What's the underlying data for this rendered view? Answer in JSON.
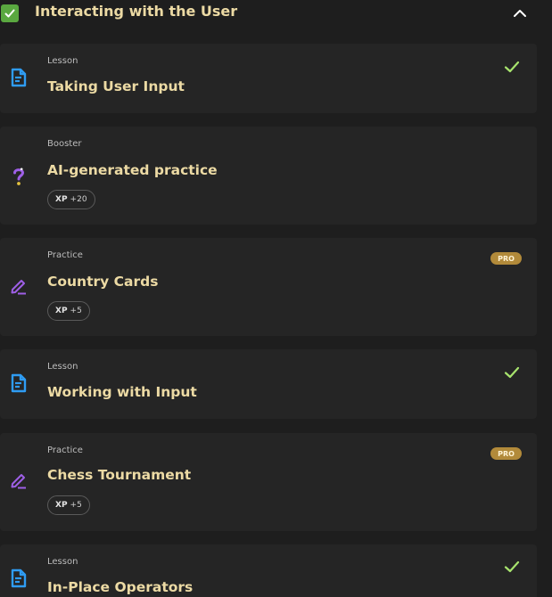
{
  "section": {
    "title": "Interacting with the User",
    "completed": true,
    "expanded": true
  },
  "items": [
    {
      "type": "Lesson",
      "title": "Taking User Input",
      "icon": "lesson-icon",
      "completed": true
    },
    {
      "type": "Booster",
      "title": "AI-generated practice",
      "icon": "question-mark-icon",
      "xp_label": "XP",
      "xp_value": "+20"
    },
    {
      "type": "Practice",
      "title": "Country Cards",
      "icon": "pencil-icon",
      "pro_label": "PRO",
      "xp_label": "XP",
      "xp_value": "+5"
    },
    {
      "type": "Lesson",
      "title": "Working with Input",
      "icon": "lesson-icon",
      "completed": true
    },
    {
      "type": "Practice",
      "title": "Chess Tournament",
      "icon": "pencil-icon",
      "pro_label": "PRO",
      "xp_label": "XP",
      "xp_value": "+5"
    },
    {
      "type": "Lesson",
      "title": "In-Place Operators",
      "icon": "lesson-icon",
      "completed": true
    }
  ],
  "colors": {
    "background": "#1e1e1e",
    "card": "#252525",
    "title": "#ecdaa4",
    "check": "#a7e36d",
    "lesson_icon": "#2f9cf3",
    "practice_icon": "#9e5fe6",
    "pro_badge": "#b28a3a"
  }
}
